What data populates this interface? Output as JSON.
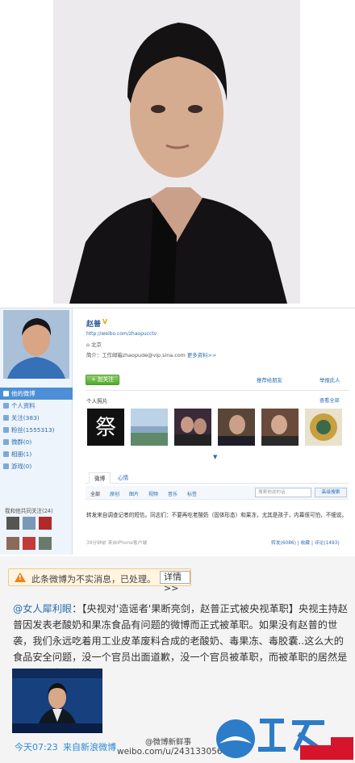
{
  "profile": {
    "name": "赵普",
    "url": "http://weibo.com/zhaopucctv",
    "location": "北京",
    "intro": "简介：工作邮箱zhaopude@vip.sina.com",
    "more_info": "更多资料>>",
    "follow_button": "+ 加关注",
    "recommend": "推荐给朋友",
    "report": "举报此人",
    "nav": [
      {
        "label": "他的微博",
        "active": true
      },
      {
        "label": "个人资料"
      },
      {
        "label": "关注(383)"
      },
      {
        "label": "粉丝(1555313)"
      },
      {
        "label": "微群(0)"
      },
      {
        "label": "相册(1)"
      },
      {
        "label": "游戏(0)"
      }
    ],
    "follow_list_title": "我和他共同关注(24)",
    "photos_title": "个人照片",
    "photos_all": "查看全部",
    "tabs": [
      "微博",
      "心情"
    ],
    "sub_tabs": [
      "全部",
      "原创",
      "图片",
      "视频",
      "音乐",
      "标签"
    ],
    "search_placeholder": "搜索他说的话",
    "advanced_search": "高级搜索",
    "post_text": "转发来自调查记者的短信。同志们：不要再吃老酸奶（固体形态）和果冻，尤其是孩子，内幕很可怕，不细说。",
    "post_meta": "39分钟前  来自iPhone客户端",
    "post_actions": "转发(6086) | 收藏 | 评论(1493)"
  },
  "post": {
    "warning_text": "此条微博为不实消息，已处理。",
    "warning_link": "详情>>",
    "author": "@女人犀利眼",
    "body": "：【央视对'造谣者'果断亮剑，赵普正式被央视革职】央视主持赵普因发表老酸奶和果冻食品有问题的微博而正式被革职。如果没有赵普的世袭，我们永远吃着用工业皮革废料合成的老酸奶、毒果冻、毒胶囊..这么大的食品安全问题，没一个官员出面道歉，没一个官员被革职，而被革职的居然是一个说了真话的人！",
    "time": "今天07:23",
    "from": "来自新浪微博",
    "watermark_1": "@微博新鲜事",
    "watermark_2": "weibo.com/u/2431330567"
  },
  "colors": {
    "link": "#2a6db2",
    "warning": "#e8851f",
    "accent_red": "#d6142b"
  },
  "icons": [
    "warning-icon",
    "v-badge-icon",
    "location-icon"
  ]
}
